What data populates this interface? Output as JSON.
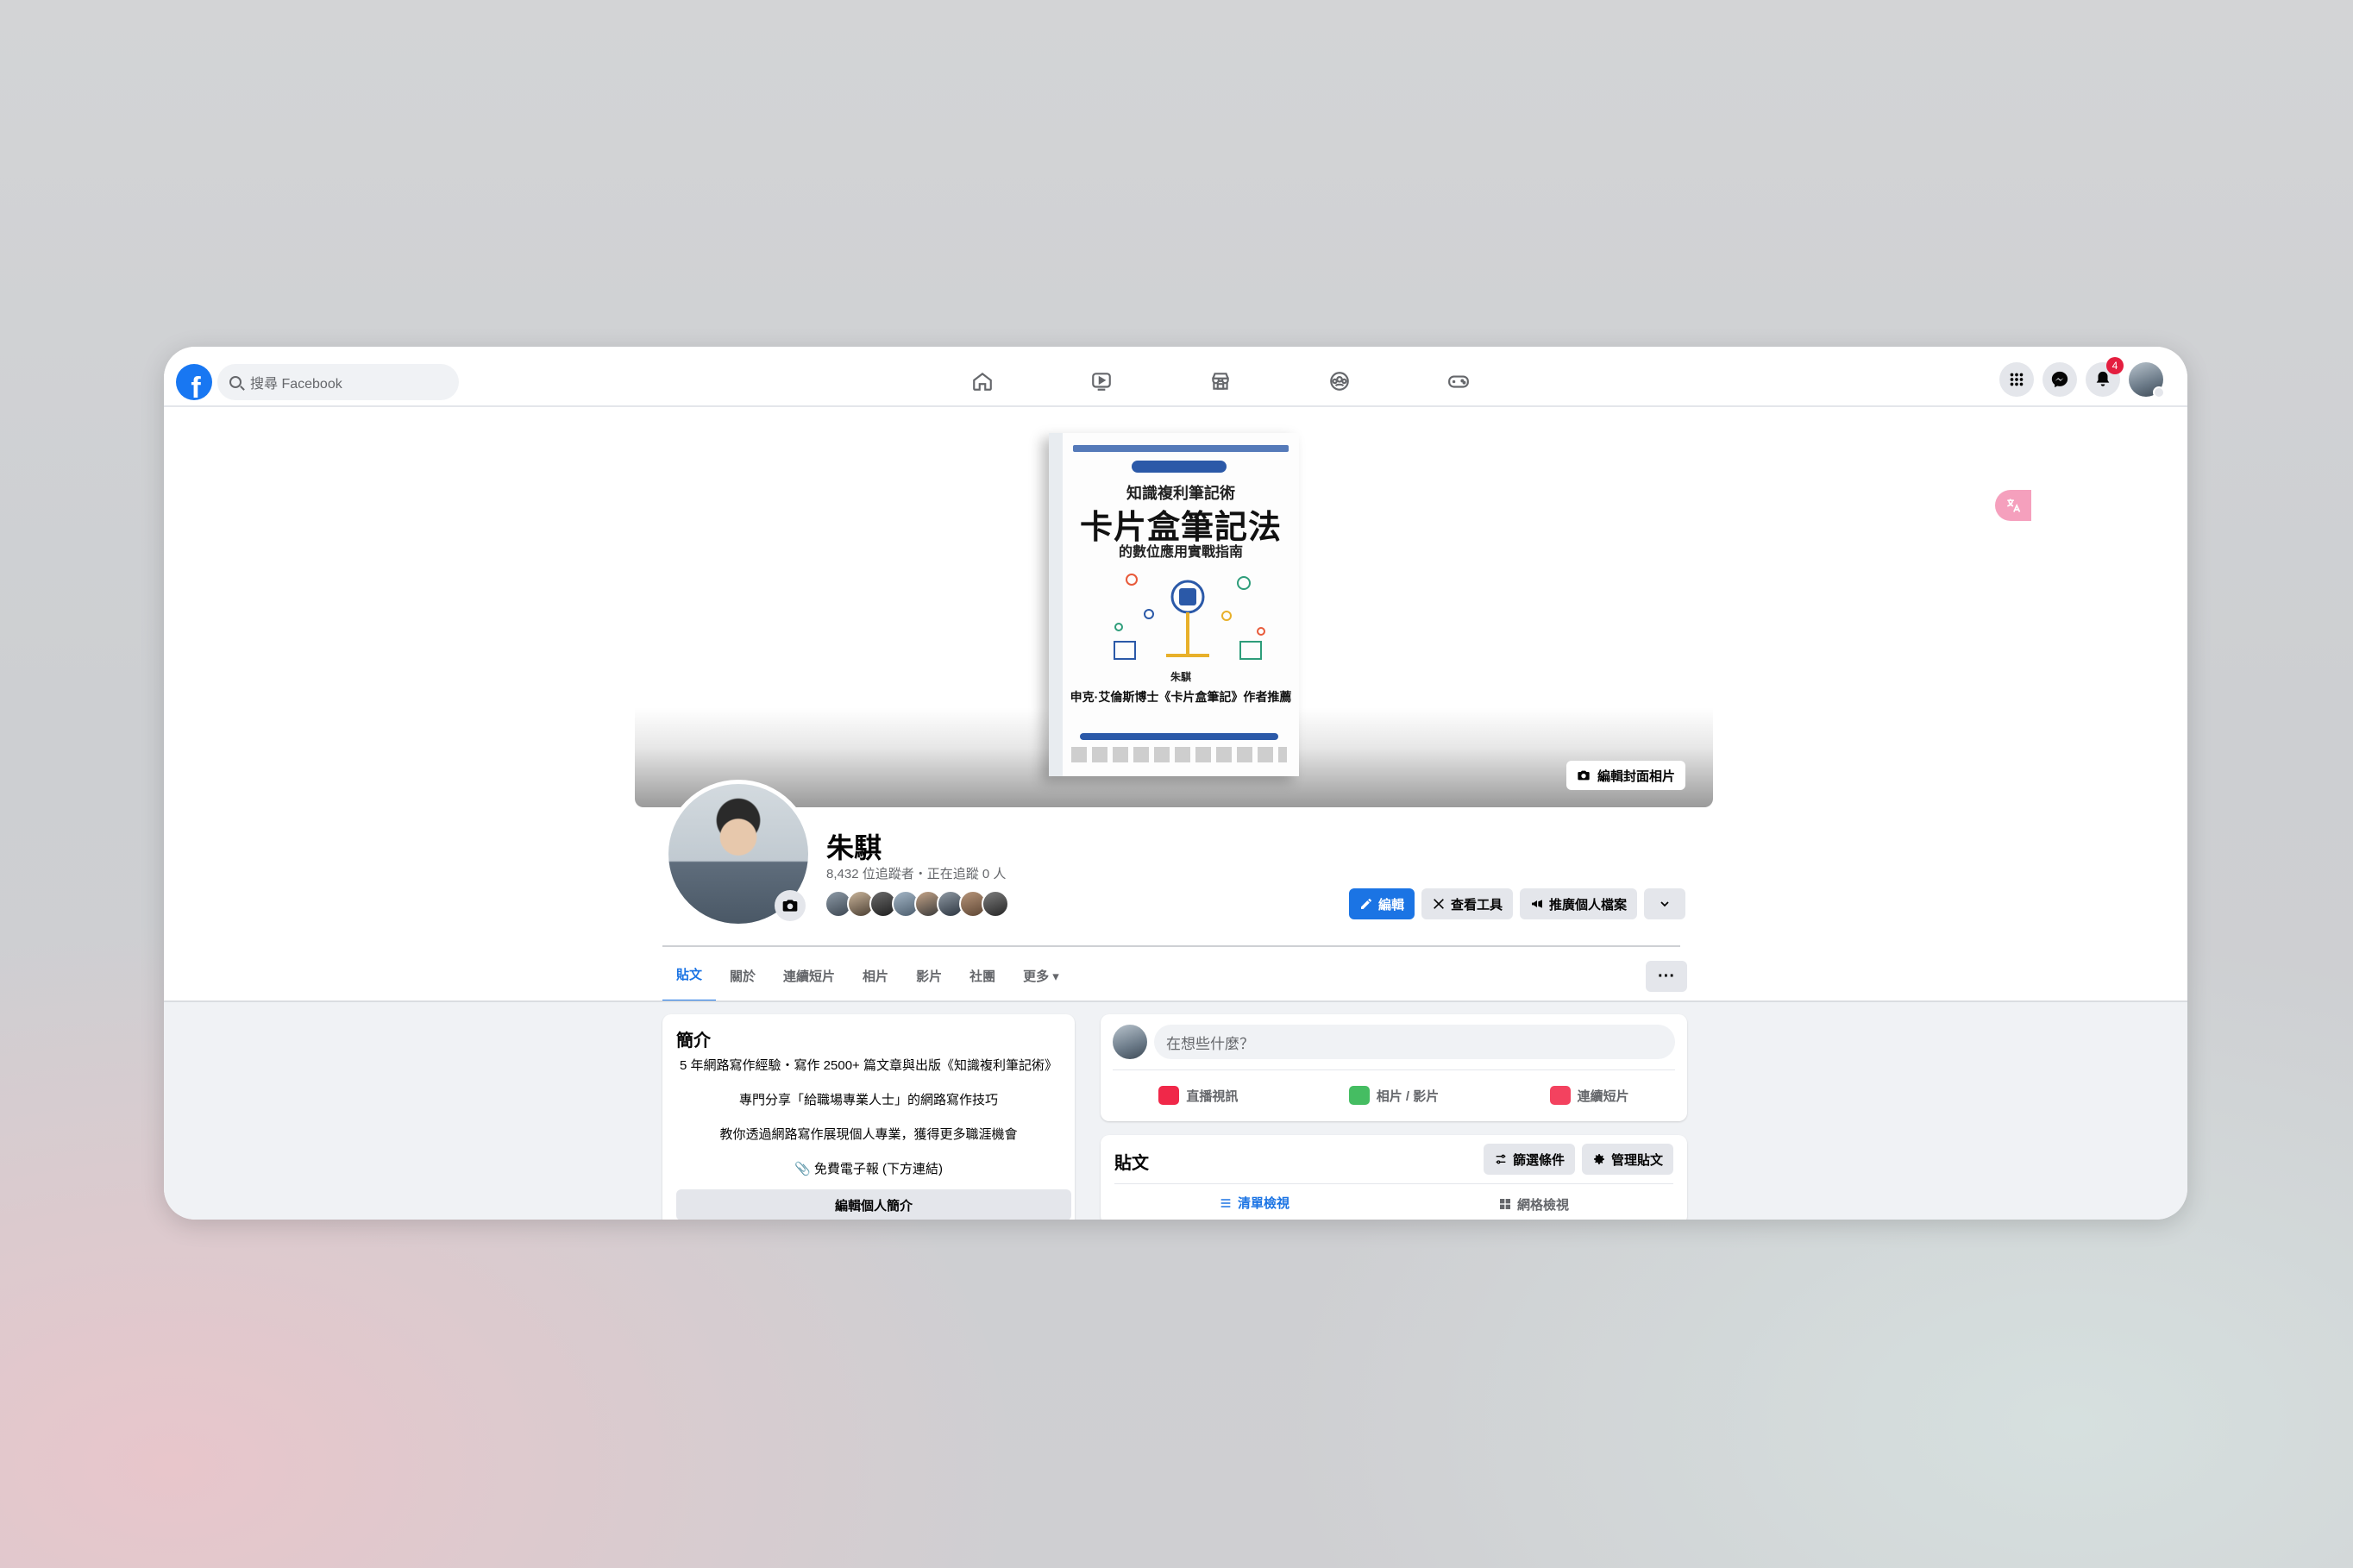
{
  "topbar": {
    "logo_letter": "f",
    "search_placeholder": "搜尋 Facebook",
    "nav": [
      "home-icon",
      "video-icon",
      "marketplace-icon",
      "groups-icon",
      "gaming-icon"
    ],
    "right": [
      "menu-grid-icon",
      "messenger-icon",
      "bell-icon",
      "account-avatar"
    ],
    "notification_count": "4"
  },
  "cover": {
    "book": {
      "subtitle": "知識複利筆記術",
      "title": "卡片盒筆記法",
      "subtitle2": "的數位應用實戰指南",
      "author": "朱騏",
      "blurb": "申克·艾倫斯博士《卡片盒筆記》作者推薦"
    },
    "edit_button": "編輯封面相片"
  },
  "profile": {
    "name": "朱騏",
    "stats": "8,432 位追蹤者・正在追蹤 0 人",
    "actions": {
      "edit": "編輯",
      "tools": "查看工具",
      "promote": "推廣個人檔案"
    }
  },
  "tabs": [
    {
      "label": "貼文",
      "active": true
    },
    {
      "label": "關於"
    },
    {
      "label": "連續短片"
    },
    {
      "label": "相片"
    },
    {
      "label": "影片"
    },
    {
      "label": "社團"
    },
    {
      "label": "更多 ▾"
    }
  ],
  "more_menu": "···",
  "intro": {
    "title": "簡介",
    "lines": [
      "5 年網路寫作經驗・寫作 2500+ 篇文章與出版《知識複利筆記術》",
      "專門分享「給職場專業人士」的網路寫作技巧",
      "教你透過網路寫作展現個人專業，獲得更多職涯機會",
      "📎 免費電子報 (下方連結)"
    ],
    "edit_button": "編輯個人簡介"
  },
  "composer": {
    "placeholder": "在想些什麼？",
    "options": [
      "直播視訊",
      "相片 / 影片",
      "連續短片"
    ]
  },
  "posts": {
    "title": "貼文",
    "filter_button": "篩選條件",
    "manage_button": "管理貼文",
    "view_list": "清單檢視",
    "view_grid": "網格檢視"
  },
  "colors": {
    "accent": "#1b74e4",
    "background": "#f0f2f5",
    "badge": "#e41e3f"
  }
}
